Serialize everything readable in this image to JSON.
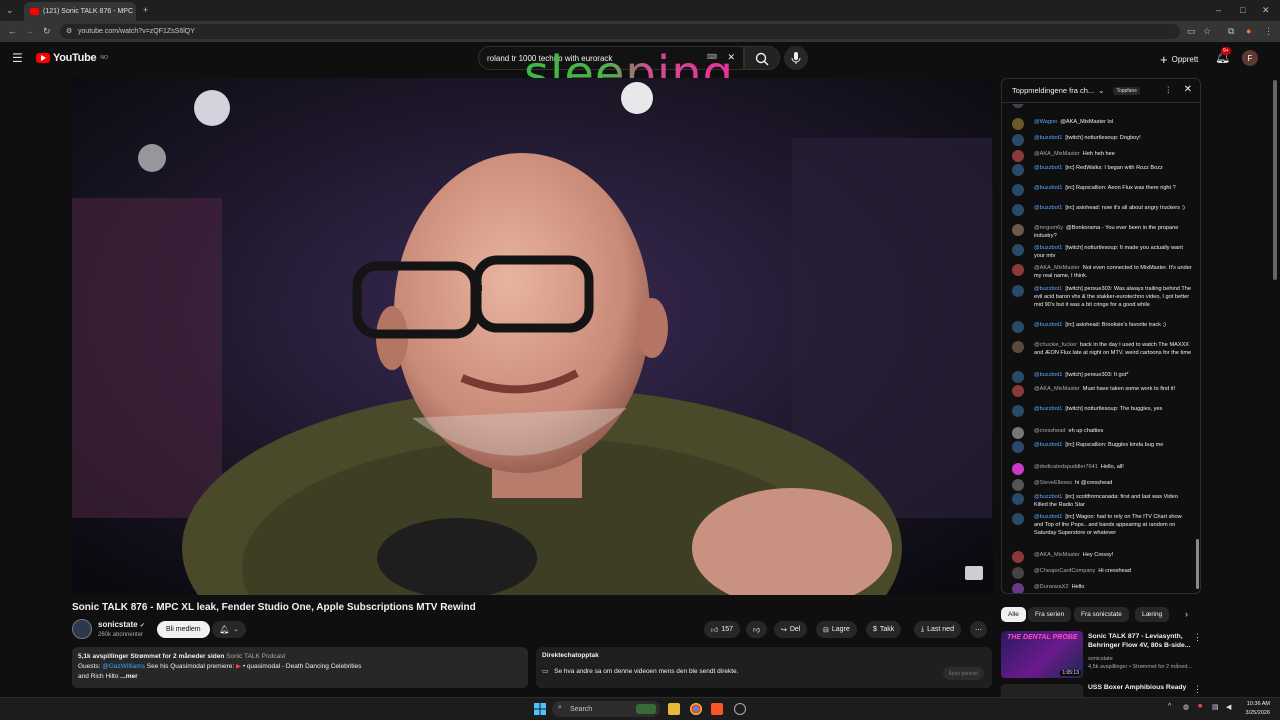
{
  "browser": {
    "tab_title": "(121) Sonic TALK 876 - MPC",
    "url": "youtube.com/watch?v=zQF1ZsS6lQY"
  },
  "header": {
    "brand": "YouTube",
    "region": "NO",
    "search_value": "roland tr 1000 techno with eurorack",
    "overlay_word": "sleeping",
    "create_label": "Opprett",
    "notif_badge": "9+",
    "avatar_letter": "F"
  },
  "video": {
    "title": "Sonic TALK 876 - MPC XL leak, Fender Studio One, Apple Subscriptions MTV Rewind",
    "channel": "sonicstate",
    "subscribers": "260k abonnenter",
    "join_label": "Bli medlem",
    "likes": "157",
    "share_label": "Del",
    "save_label": "Lagre",
    "thanks_label": "Takk",
    "download_label": "Last ned"
  },
  "description": {
    "stats": "5,1k avspillinger",
    "streamed": "Strømmet for 2 måneder siden",
    "podcast": "Sonic TALK Podcast",
    "guests_label": "Guests:",
    "guest1": "@GazWilliams",
    "line1_rest": "See his Quasimodal premiere:",
    "premiere": "• quasimodal - Death Dancing Celebrities",
    "line2": "and Rich Hilto",
    "more": "...mer"
  },
  "live_replay": {
    "heading": "Direktechatopptak",
    "text": "Se hva andre sa om denne videoen mens den ble sendt direkte.",
    "button": "Åpne panelet"
  },
  "chat": {
    "header_title": "Toppmeldingene fra ch...",
    "top_fans": "Toppfans",
    "messages": [
      {
        "author": "",
        "text": "was dope"
      },
      {
        "author": "@Wagoo",
        "text": "@AKA_MixMaster lol"
      },
      {
        "author": "@buzzbot1",
        "text": "[twitch] notturtlesoup: Dogboy!"
      },
      {
        "author": "@AKA_MixMaster",
        "text": "Heh heh hee"
      },
      {
        "author": "@buzzbot1",
        "text": "[irc] RedWalks: I began with Rozz Bozz"
      },
      {
        "author": "@buzzbot1",
        "text": "[irc] Rapscallion: Aeon Flux was there right ?"
      },
      {
        "author": "@buzzbot1",
        "text": "[irc] asiohead: now it's all about angry truckers :)"
      },
      {
        "author": "@mrgum6y",
        "text": "@Bonkorama - You ever been in the propane industry?"
      },
      {
        "author": "@buzzbot1",
        "text": "[twitch] notturtlesoup: It made you actually want your mtv"
      },
      {
        "author": "@AKA_MixMaster",
        "text": "Not even connected to MixMaster. It's under my real name, I think."
      },
      {
        "author": "@buzzbot1",
        "text": "[twitch] persue303: Was always trailing behind The evil acid baron vhs & the stakker-eurotechno video, I got better mid 90's but it was a bit cringe for a good while"
      },
      {
        "author": "@buzzbot1",
        "text": "[irc] asiohead: Brooksie's favorite track ;)"
      },
      {
        "author": "@chuckie_fucker",
        "text": "back in the day I used to watch The MAXXX and ÆON Flux late at night on MTV. weird cartoons for the time"
      },
      {
        "author": "@buzzbot1",
        "text": "[twitch] persue303: It got*"
      },
      {
        "author": "@AKA_MixMaster",
        "text": "Must have taken some work to find it!"
      },
      {
        "author": "@buzzbot1",
        "text": "[twitch] notturtlesoup: The buggles, yes"
      },
      {
        "author": "@cresshead",
        "text": "eh up chatties"
      },
      {
        "author": "@buzzbot1",
        "text": "[irc] Rapscallion: Buggles kinda bug me"
      },
      {
        "author": "@dedicatedspuddler7641",
        "text": "Hello, all!"
      },
      {
        "author": "@SteveElbows",
        "text": "hi @cresshead"
      },
      {
        "author": "@buzzbot1",
        "text": "[irc] scottfromcanada: first and last was Video Killed the Radio Star"
      },
      {
        "author": "@buzzbot1",
        "text": "[irc] Wagoo: had to rely on The ITV Chart show and Top of the Pops.. and bands appearing at random on Saturday Superstore or whatever"
      },
      {
        "author": "@AKA_MixMaster",
        "text": "Hey Cressy!"
      },
      {
        "author": "@CheapoCardCompany",
        "text": "Hi cresshead"
      },
      {
        "author": "@DurararaX2",
        "text": "Hello"
      }
    ]
  },
  "suggestions": {
    "chips": [
      "Alle",
      "Fra serien",
      "Fra sonicstate",
      "Læring"
    ],
    "items": [
      {
        "thumb_text": "THE DENTAL PROBE",
        "duration": "1:05:13",
        "title": "Sonic TALK 877 - Leviasynth, Behringer Flow 4V, 80s B-side...",
        "channel": "sonicstate",
        "meta": "4,5k avspillinger • Strømmet for 2 måned..."
      },
      {
        "title": "USS Boxer Amphibious Ready"
      }
    ]
  },
  "taskbar": {
    "search_label": "Search",
    "time": "10:36 AM",
    "date": "3/25/2026"
  }
}
